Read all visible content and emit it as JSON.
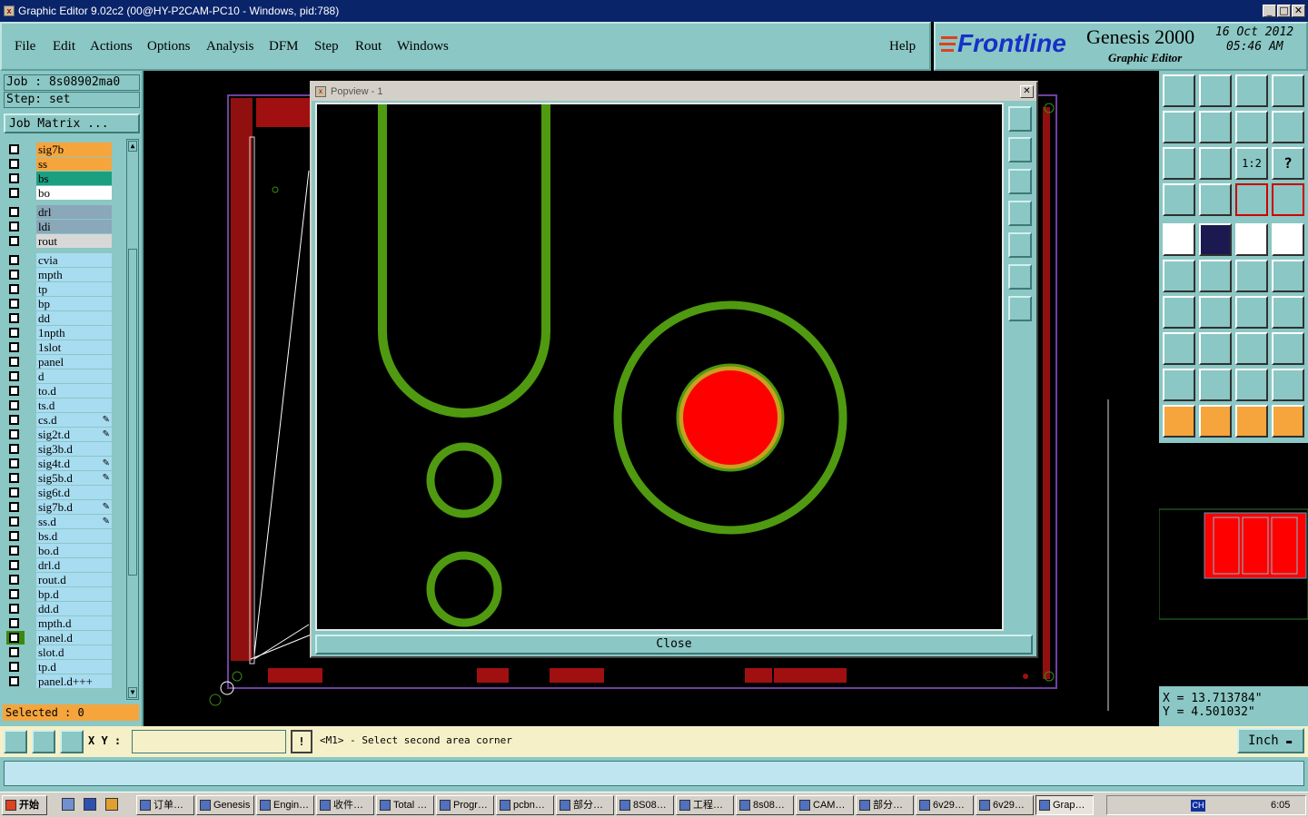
{
  "window": {
    "title": "Graphic Editor 9.02c2 (00@HY-P2CAM-PC10 - Windows, pid:788)",
    "minimize": "_",
    "maximize": "□",
    "close": "✕"
  },
  "menu": {
    "items": [
      "File",
      "Edit",
      "Actions",
      "Options",
      "Analysis",
      "DFM",
      "Step",
      "Rout",
      "Windows"
    ],
    "help": "Help"
  },
  "brand": {
    "logo": "Frontline",
    "product": "Genesis 2000",
    "subtitle": "Graphic Editor",
    "date": "16 Oct 2012",
    "time": "05:46 AM"
  },
  "job": {
    "job_line": "Job : 8s08902ma0",
    "step_line": "Step: set",
    "matrix_button": "Job Matrix ..."
  },
  "layers": [
    {
      "name": "sig7b",
      "color": "#f6a53c"
    },
    {
      "name": "ss",
      "color": "#f6a53c"
    },
    {
      "name": "bs",
      "color": "#1aa080"
    },
    {
      "name": "bo",
      "color": "#ffffff"
    },
    {
      "name": "drl",
      "color": "#8aa8ba"
    },
    {
      "name": "ldi",
      "color": "#8aa8ba"
    },
    {
      "name": "rout",
      "color": "#d8d8d8"
    },
    {
      "name": "cvia",
      "color": "#a8dcf0"
    },
    {
      "name": "mpth",
      "color": "#a8dcf0"
    },
    {
      "name": "tp",
      "color": "#a8dcf0"
    },
    {
      "name": "bp",
      "color": "#a8dcf0"
    },
    {
      "name": "dd",
      "color": "#a8dcf0"
    },
    {
      "name": "1npth",
      "color": "#a8dcf0"
    },
    {
      "name": "1slot",
      "color": "#a8dcf0"
    },
    {
      "name": "panel",
      "color": "#a8dcf0"
    },
    {
      "name": "d",
      "color": "#a8dcf0"
    },
    {
      "name": "to.d",
      "color": "#a8dcf0"
    },
    {
      "name": "ts.d",
      "color": "#a8dcf0"
    },
    {
      "name": "cs.d",
      "color": "#a8dcf0",
      "mark": "✎"
    },
    {
      "name": "sig2t.d",
      "color": "#a8dcf0",
      "mark": "✎"
    },
    {
      "name": "sig3b.d",
      "color": "#a8dcf0"
    },
    {
      "name": "sig4t.d",
      "color": "#a8dcf0",
      "mark": "✎"
    },
    {
      "name": "sig5b.d",
      "color": "#a8dcf0",
      "mark": "✎"
    },
    {
      "name": "sig6t.d",
      "color": "#a8dcf0"
    },
    {
      "name": "sig7b.d",
      "color": "#a8dcf0",
      "mark": "✎"
    },
    {
      "name": "ss.d",
      "color": "#a8dcf0",
      "mark": "✎"
    },
    {
      "name": "bs.d",
      "color": "#a8dcf0"
    },
    {
      "name": "bo.d",
      "color": "#a8dcf0"
    },
    {
      "name": "drl.d",
      "color": "#a8dcf0"
    },
    {
      "name": "rout.d",
      "color": "#a8dcf0"
    },
    {
      "name": "bp.d",
      "color": "#a8dcf0"
    },
    {
      "name": "dd.d",
      "color": "#a8dcf0"
    },
    {
      "name": "mpth.d",
      "color": "#a8dcf0"
    },
    {
      "name": "panel.d",
      "color": "#a8dcf0",
      "active": true
    },
    {
      "name": "slot.d",
      "color": "#a8dcf0"
    },
    {
      "name": "tp.d",
      "color": "#a8dcf0"
    },
    {
      "name": "panel.d+++",
      "color": "#a8dcf0"
    }
  ],
  "selected": "Selected : 0",
  "popview": {
    "title": "Popview - 1",
    "close_label": "Close"
  },
  "coords": {
    "x": "X = 13.713784\"",
    "y": "Y = 4.501032\""
  },
  "status": {
    "xy_label": "X Y :",
    "message": "<M1> - Select second area corner",
    "unit": "Inch",
    "warn": "!"
  },
  "taskbar": {
    "start": "开始",
    "tasks": [
      "订单…",
      "Genesis",
      "Engin…",
      "收件…",
      "Total …",
      "Progr…",
      "pcbn…",
      "部分…",
      "8S08…",
      "工程…",
      "8s08…",
      "CAM…",
      "部分…",
      "6v29…",
      "6v29…",
      "Grap…"
    ],
    "clock": "6:05",
    "lang": "CH"
  },
  "colors": {
    "accent": "#8bc7c4",
    "trace": "#4f9a10",
    "pad": "#ff0000",
    "pad_ring": "#c8a020"
  }
}
